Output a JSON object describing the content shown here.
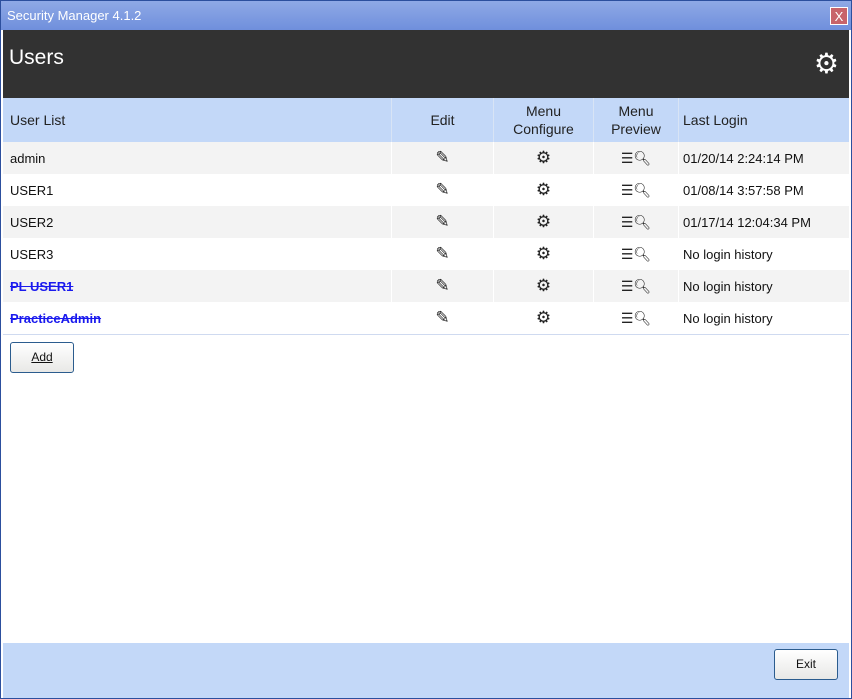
{
  "window": {
    "title": "Security Manager 4.1.2",
    "close_label": "X"
  },
  "header": {
    "title": "Users"
  },
  "table": {
    "columns": {
      "user": "User List",
      "edit": "Edit",
      "menu_configure": "Menu\nConfigure",
      "menu_preview": "Menu\nPreview",
      "last_login": "Last Login"
    },
    "rows": [
      {
        "user": "admin",
        "last_login": "01/20/14 2:24:14 PM",
        "disabled": false
      },
      {
        "user": "USER1",
        "last_login": "01/08/14 3:57:58 PM",
        "disabled": false
      },
      {
        "user": "USER2",
        "last_login": "01/17/14 12:04:34 PM",
        "disabled": false
      },
      {
        "user": "USER3",
        "last_login": "No login history",
        "disabled": false
      },
      {
        "user": "PL USER1",
        "last_login": "No login history",
        "disabled": true
      },
      {
        "user": "PracticeAdmin",
        "last_login": "No login history",
        "disabled": true
      }
    ]
  },
  "buttons": {
    "add": "Add",
    "exit": "Exit"
  }
}
